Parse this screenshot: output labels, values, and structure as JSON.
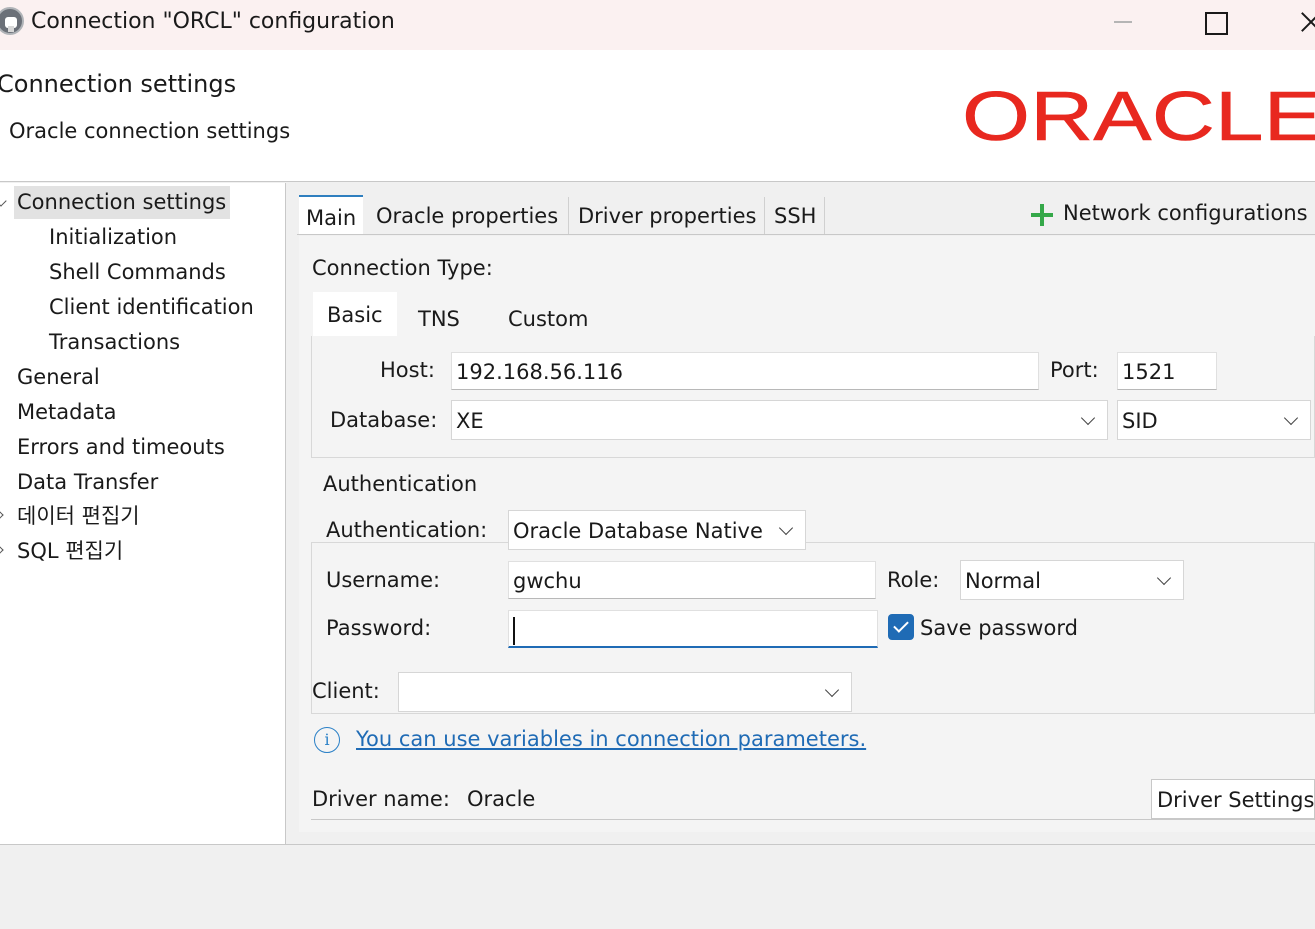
{
  "window": {
    "title": "Connection \"ORCL\" configuration",
    "icon": "dbeaver-icon"
  },
  "header": {
    "title": "Connection settings",
    "subtitle": "Oracle connection settings",
    "logo_text": "ORACLE",
    "logo_color": "#e8281f"
  },
  "tree": {
    "items": [
      {
        "label": "Connection settings",
        "selected": true,
        "expanded": true
      },
      {
        "label": "Initialization"
      },
      {
        "label": "Shell Commands"
      },
      {
        "label": "Client identification"
      },
      {
        "label": "Transactions"
      },
      {
        "label": "General"
      },
      {
        "label": "Metadata"
      },
      {
        "label": "Errors and timeouts"
      },
      {
        "label": "Data Transfer"
      },
      {
        "label": "데이터 편집기"
      },
      {
        "label": "SQL 편집기"
      }
    ]
  },
  "tabs": [
    "Main",
    "Oracle properties",
    "Driver properties",
    "SSH"
  ],
  "network_configurations": "Network configurations",
  "main": {
    "connection_type_label": "Connection Type:",
    "subtabs": [
      "Basic",
      "TNS",
      "Custom"
    ],
    "host_label": "Host:",
    "host_value": "192.168.56.116",
    "port_label": "Port:",
    "port_value": "1521",
    "database_label": "Database:",
    "database_value": "XE",
    "database_type": "SID",
    "auth_group_title": "Authentication",
    "auth_label": "Authentication:",
    "auth_value": "Oracle Database Native",
    "username_label": "Username:",
    "username_value": "gwchu",
    "role_label": "Role:",
    "role_value": "Normal",
    "password_label": "Password:",
    "password_value": "",
    "save_password_label": "Save password",
    "save_password_checked": true,
    "client_label": "Client:",
    "client_value": "",
    "variables_link": "You can use variables in connection parameters.",
    "driver_name_label": "Driver name:",
    "driver_name_value": "Oracle",
    "driver_settings_button": "Driver Settings"
  }
}
